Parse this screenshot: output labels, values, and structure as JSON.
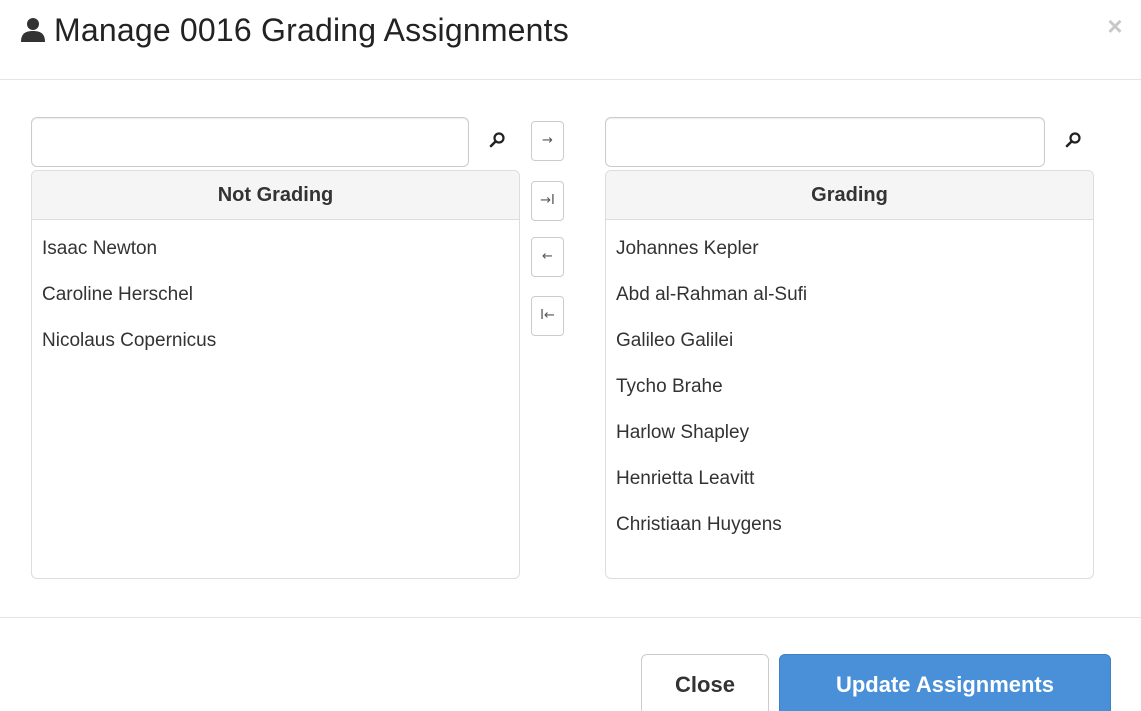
{
  "modal": {
    "title": "Manage 0016 Grading Assignments",
    "close_glyph": "×",
    "user_icon": "user-icon"
  },
  "left_panel": {
    "search_value": "",
    "search_icon": "search-icon",
    "header": "Not Grading",
    "items": [
      "Isaac Newton",
      "Caroline Herschel",
      "Nicolaus Copernicus"
    ]
  },
  "right_panel": {
    "search_value": "",
    "search_icon": "search-icon",
    "header": "Grading",
    "items": [
      "Johannes Kepler",
      "Abd al-Rahman al-Sufi",
      "Galileo Galilei",
      "Tycho Brahe",
      "Harlow Shapley",
      "Henrietta Leavitt",
      "Christiaan Huygens"
    ]
  },
  "move_buttons": {
    "move_selected_right": "→",
    "move_all_right": "→I",
    "move_selected_left": "←",
    "move_all_left": "I←"
  },
  "footer": {
    "close_label": "Close",
    "update_label": "Update Assignments"
  },
  "colors": {
    "primary": "#4a90d9",
    "header_bg": "#f5f5f5",
    "border": "#dddddd"
  }
}
